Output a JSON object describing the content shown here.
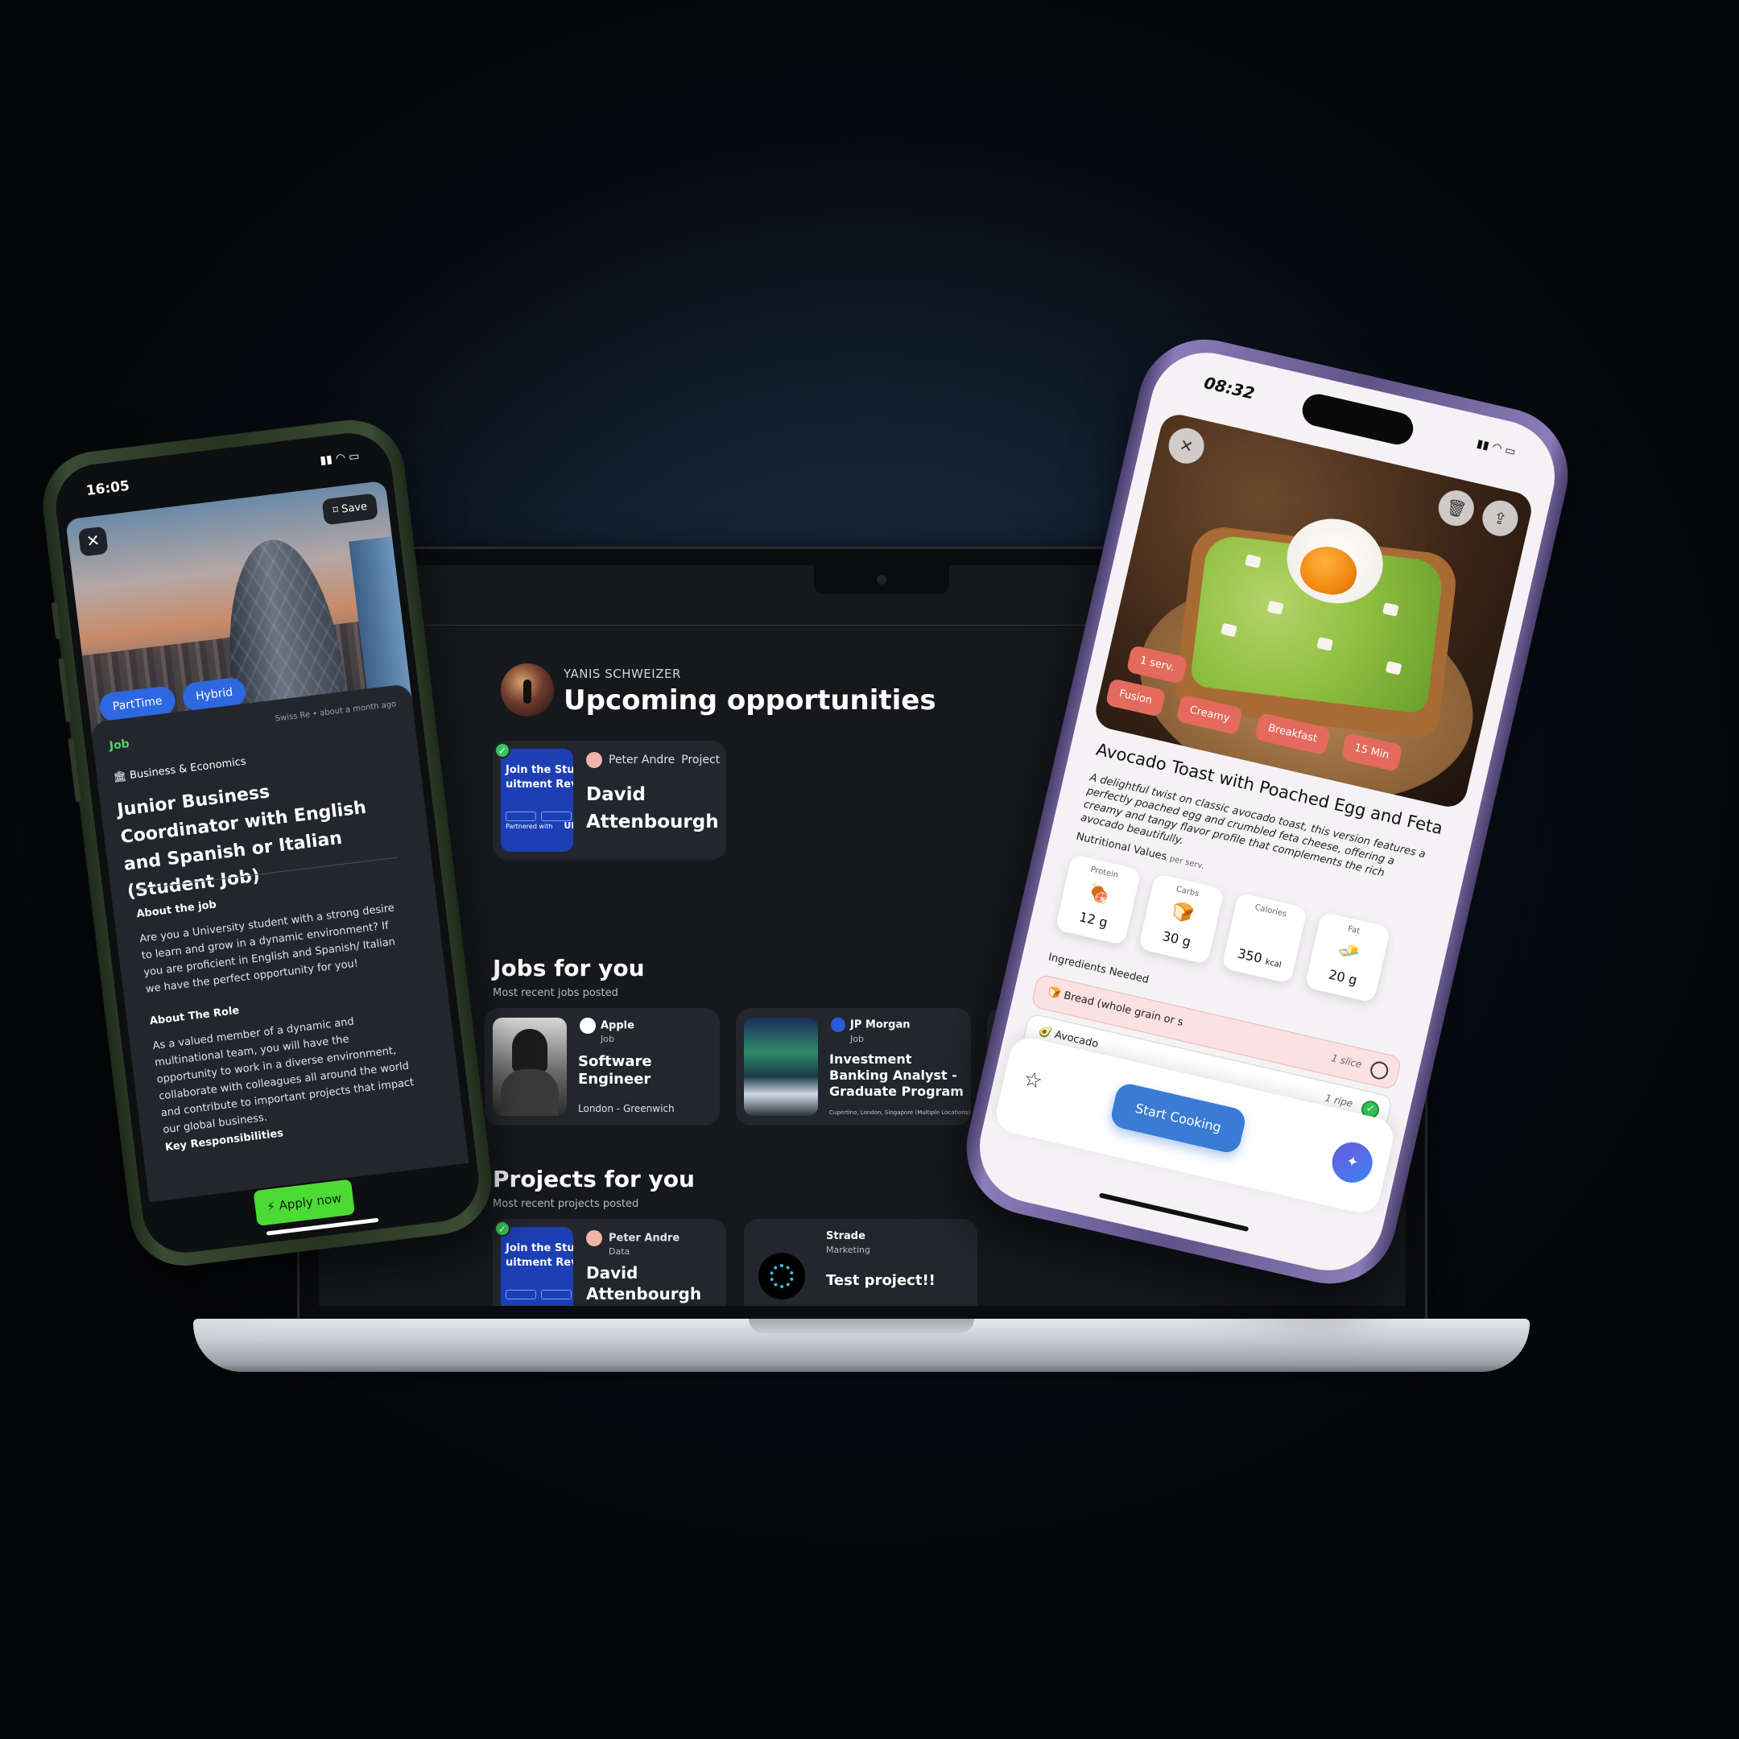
{
  "laptop": {
    "greeting": "YANIS SCHWEIZER",
    "heading": "Upcoming opportunities",
    "upcoming_card": {
      "thumb_title_1": "Join the Studen",
      "thumb_title_2": "uitment Revolu",
      "thumb_partner": "Partnered with",
      "thumb_brand": "UNIDAY",
      "author": "Peter Andre",
      "type": "Project",
      "name": "David Attenbourgh"
    },
    "jobs": {
      "title": "Jobs for you",
      "subtitle": "Most recent jobs posted",
      "items": [
        {
          "company": "Apple",
          "kind": "Job",
          "title": "Software Engineer",
          "location": "London - Greenwich"
        },
        {
          "company": "JP Morgan",
          "kind": "Job",
          "title": "Investment Banking Analyst - Graduate Program",
          "location": "Cupertino, London, Singapore (Multiple Locations)"
        }
      ]
    },
    "projects": {
      "title": "Projects for you",
      "subtitle": "Most recent projects posted",
      "items": [
        {
          "author": "Peter Andre",
          "kind": "Data",
          "name": "David Attenbourgh"
        },
        {
          "author": "Strade",
          "kind": "Marketing",
          "name": "Test project!!"
        }
      ]
    }
  },
  "phone_left": {
    "time": "16:05",
    "save_label": "Save",
    "close_glyph": "✕",
    "tags": [
      "PartTime",
      "Hybrid"
    ],
    "job_tag": "Job",
    "company_meta": "Swiss Re • about a month ago",
    "category": "Business & Economics",
    "title": "Junior Business Coordinator with English and Spanish or Italian (Student Job)",
    "about_h": "About the job",
    "about_p": "Are you a University student with a strong desire to learn and grow in a dynamic environment? If you are proficient in English and Spanish/ Italian we have the perfect opportunity for you!",
    "role_h": "About The Role",
    "role_p": "As a valued member of a dynamic and multinational team, you will have the opportunity to work in a diverse environment, collaborate with colleagues all around the world and contribute to important projects that impact our global business.",
    "resp_h": "Key Responsibilities",
    "apply_label": "Apply now"
  },
  "phone_right": {
    "time": "08:32",
    "tags": [
      "1 serv.",
      "Fusion",
      "Creamy",
      "Breakfast",
      "15 Min"
    ],
    "title": "Avocado Toast with Poached Egg and Feta",
    "description": "A delightful twist on classic avocado toast, this version features a perfectly poached egg and crumbled feta cheese, offering a creamy and tangy flavor profile that complements the rich avocado beautifully.",
    "nutrition_heading": "Nutritional Values",
    "nutrition_unit": "per serv.",
    "nutrition": [
      {
        "label": "Protein",
        "icon": "🍖",
        "value": "12 g"
      },
      {
        "label": "Carbs",
        "icon": "🍞",
        "value": "30 g"
      },
      {
        "label": "Calories",
        "icon": "⚡",
        "value": "350",
        "unit": "kcal"
      },
      {
        "label": "Fat",
        "icon": "🧈",
        "value": "20 g"
      }
    ],
    "ingredients_heading": "Ingredients Needed",
    "ingredients": [
      {
        "name": "Bread (whole grain or s",
        "qty": "1 slice"
      },
      {
        "name": "Avocado",
        "qty": "1 ripe"
      }
    ],
    "start_label": "Start Cooking"
  }
}
